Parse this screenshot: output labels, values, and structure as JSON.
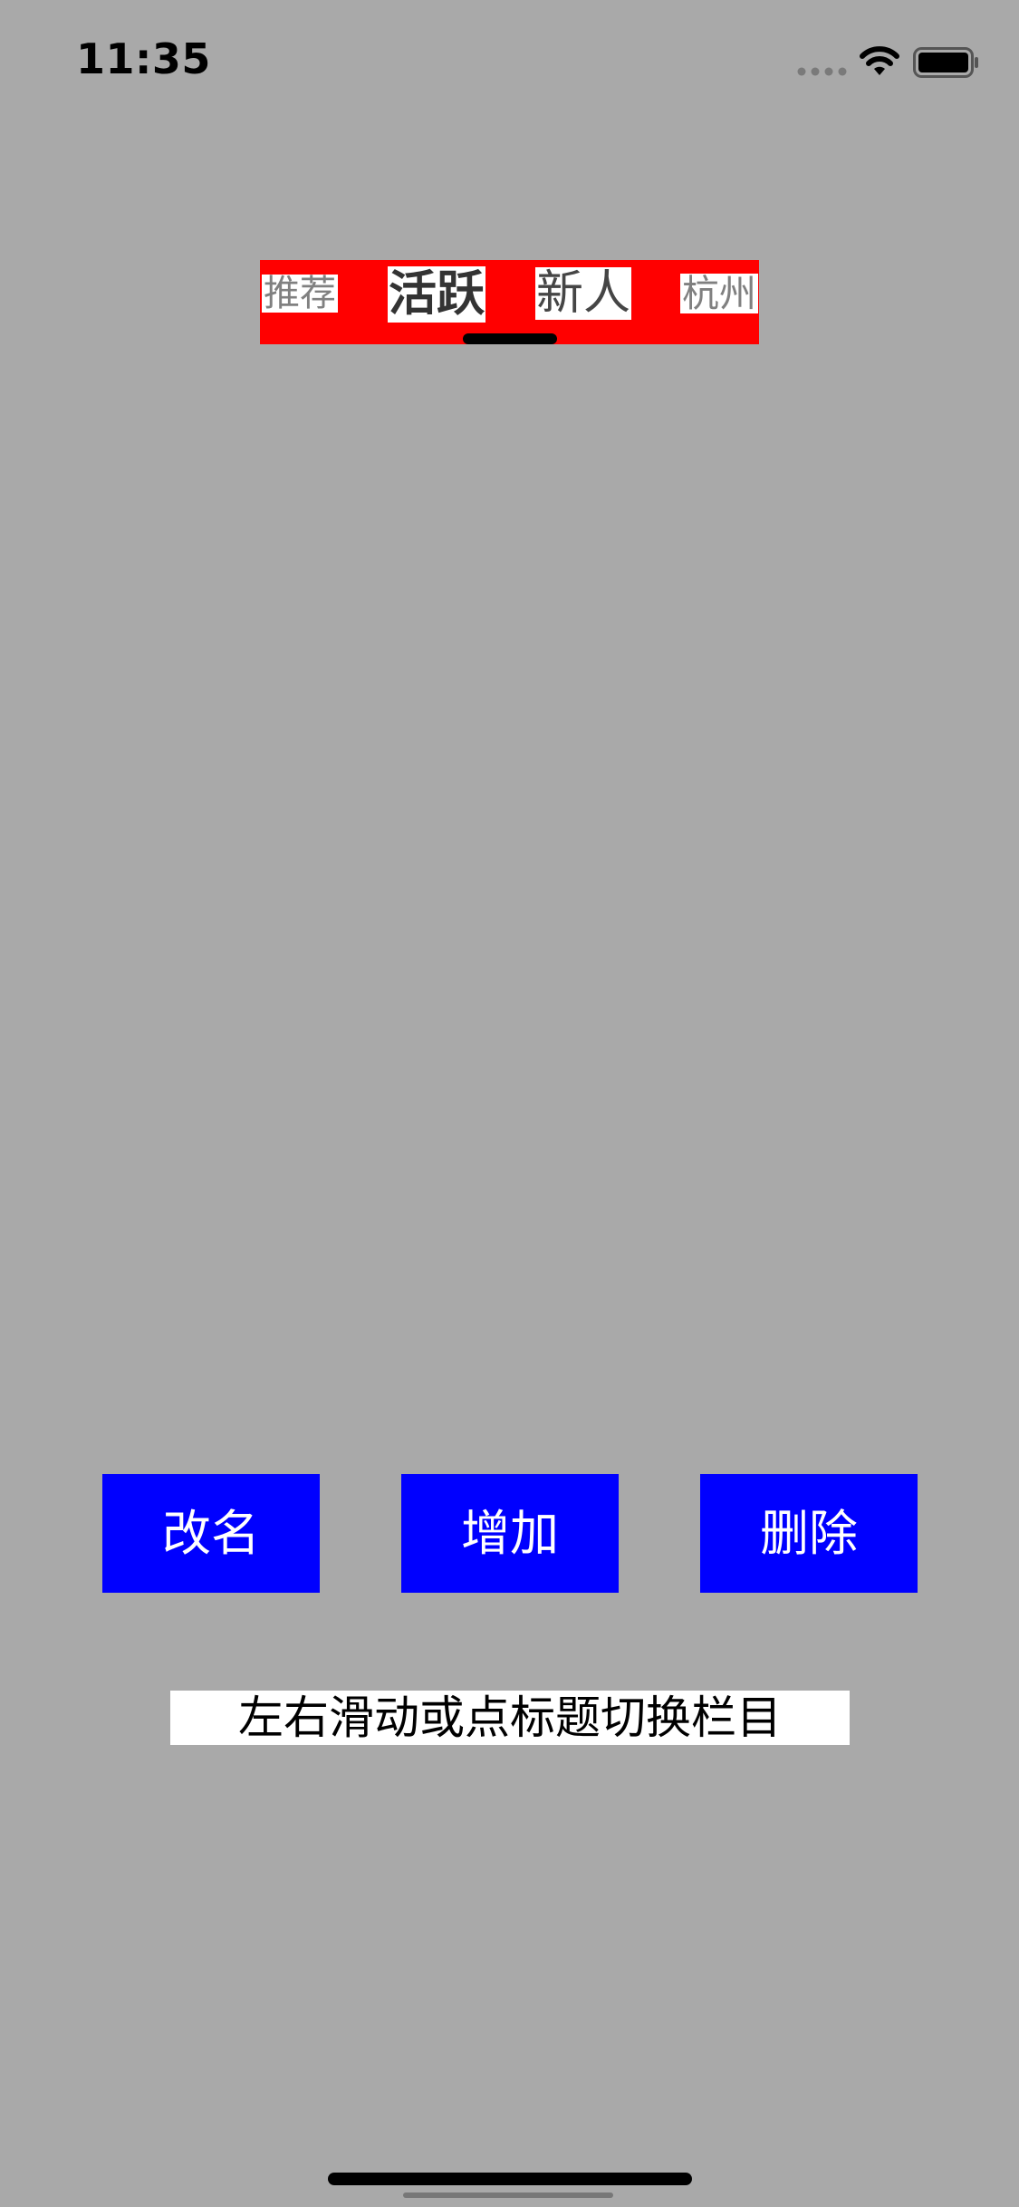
{
  "status_bar": {
    "time": "11:35",
    "signal_icon": "signal-dots-icon",
    "wifi_icon": "wifi-icon",
    "battery_icon": "battery-icon"
  },
  "colors": {
    "background": "#a9a9a9",
    "tabbar_background": "#ff0000",
    "button_background": "#0000ff",
    "button_text": "#ffffff"
  },
  "tabs": {
    "items": [
      {
        "label": "推荐"
      },
      {
        "label": "活跃"
      },
      {
        "label": "新人"
      },
      {
        "label": "杭州"
      }
    ],
    "selected": "活跃"
  },
  "actions": {
    "rename_label": "改名",
    "add_label": "增加",
    "delete_label": "删除"
  },
  "hint": {
    "text": "左右滑动或点标题切换栏目"
  }
}
